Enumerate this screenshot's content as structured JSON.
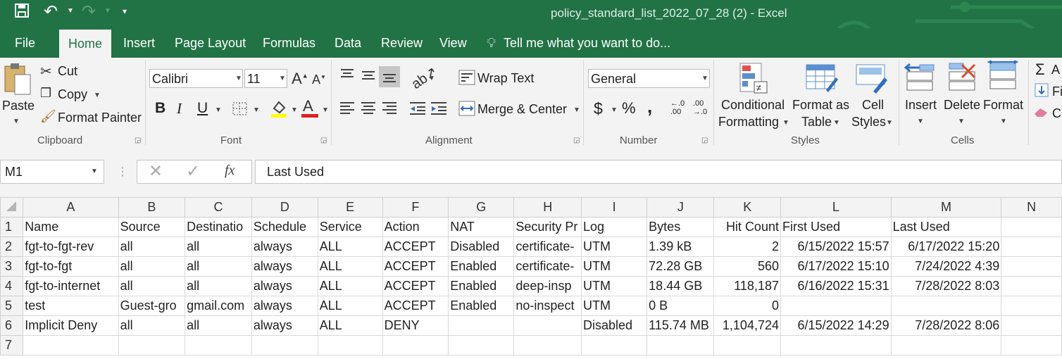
{
  "title": "policy_standard_list_2022_07_28 (2) - Excel",
  "tabs": [
    "File",
    "Home",
    "Insert",
    "Page Layout",
    "Formulas",
    "Data",
    "Review",
    "View"
  ],
  "tell_me": "Tell me what you want to do...",
  "clipboard": {
    "paste": "Paste",
    "cut": "Cut",
    "copy": "Copy",
    "format_painter": "Format Painter",
    "group": "Clipboard"
  },
  "font": {
    "name": "Calibri",
    "size": "11",
    "bold": "B",
    "italic": "I",
    "underline": "U",
    "group": "Font"
  },
  "alignment": {
    "wrap": "Wrap Text",
    "merge": "Merge & Center",
    "group": "Alignment"
  },
  "number": {
    "format": "General",
    "currency": "$",
    "percent": "%",
    "comma": ",",
    "group": "Number"
  },
  "styles": {
    "conditional_1": "Conditional",
    "conditional_2": "Formatting",
    "table_1": "Format as",
    "table_2": "Table",
    "cell_1": "Cell",
    "cell_2": "Styles",
    "group": "Styles"
  },
  "cells": {
    "insert": "Insert",
    "delete": "Delete",
    "format": "Format",
    "group": "Cells"
  },
  "editing": {
    "sum": "A",
    "fill": "Fi",
    "clear": "Cl"
  },
  "formula_bar": {
    "name_box": "M1",
    "fx": "fx",
    "value": "Last Used"
  },
  "columns": [
    "A",
    "B",
    "C",
    "D",
    "E",
    "F",
    "G",
    "H",
    "I",
    "J",
    "K",
    "L",
    "M",
    "N"
  ],
  "rows": [
    {
      "n": "1",
      "cells": [
        "Name",
        "Source",
        "Destinatio",
        "Schedule",
        "Service",
        "Action",
        "NAT",
        "Security Pr",
        "Log",
        "Bytes",
        "Hit Count",
        "First Used",
        "Last Used",
        ""
      ]
    },
    {
      "n": "2",
      "cells": [
        "fgt-to-fgt-rev",
        "all",
        "all",
        "always",
        "ALL",
        "ACCEPT",
        "Disabled",
        "certificate-",
        "UTM",
        "1.39 kB",
        "2",
        "6/15/2022 15:57",
        "6/17/2022 15:20",
        ""
      ]
    },
    {
      "n": "3",
      "cells": [
        "fgt-to-fgt",
        "all",
        "all",
        "always",
        "ALL",
        "ACCEPT",
        "Enabled",
        "certificate-",
        "UTM",
        "72.28 GB",
        "560",
        "6/17/2022 15:10",
        "7/24/2022 4:39",
        ""
      ]
    },
    {
      "n": "4",
      "cells": [
        "fgt-to-internet",
        "all",
        "all",
        "always",
        "ALL",
        "ACCEPT",
        "Enabled",
        "deep-insp",
        "UTM",
        "18.44 GB",
        "118,187",
        "6/16/2022 15:31",
        "7/28/2022 8:03",
        ""
      ]
    },
    {
      "n": "5",
      "cells": [
        "test",
        "Guest-gro",
        "gmail.com",
        "always",
        "ALL",
        "ACCEPT",
        "Enabled",
        "no-inspect",
        "UTM",
        "0 B",
        "0",
        "",
        "",
        ""
      ]
    },
    {
      "n": "6",
      "cells": [
        "Implicit Deny",
        "all",
        "all",
        "always",
        "ALL",
        "DENY",
        "",
        "",
        "Disabled",
        "115.74 MB",
        "1,104,724",
        "6/15/2022 14:29",
        "7/28/2022 8:06",
        ""
      ]
    },
    {
      "n": "7",
      "cells": [
        "",
        "",
        "",
        "",
        "",
        "",
        "",
        "",
        "",
        "",
        "",
        "",
        "",
        ""
      ]
    }
  ],
  "colors": {
    "brand": "#217346",
    "ribbon": "#f3f3f3"
  }
}
